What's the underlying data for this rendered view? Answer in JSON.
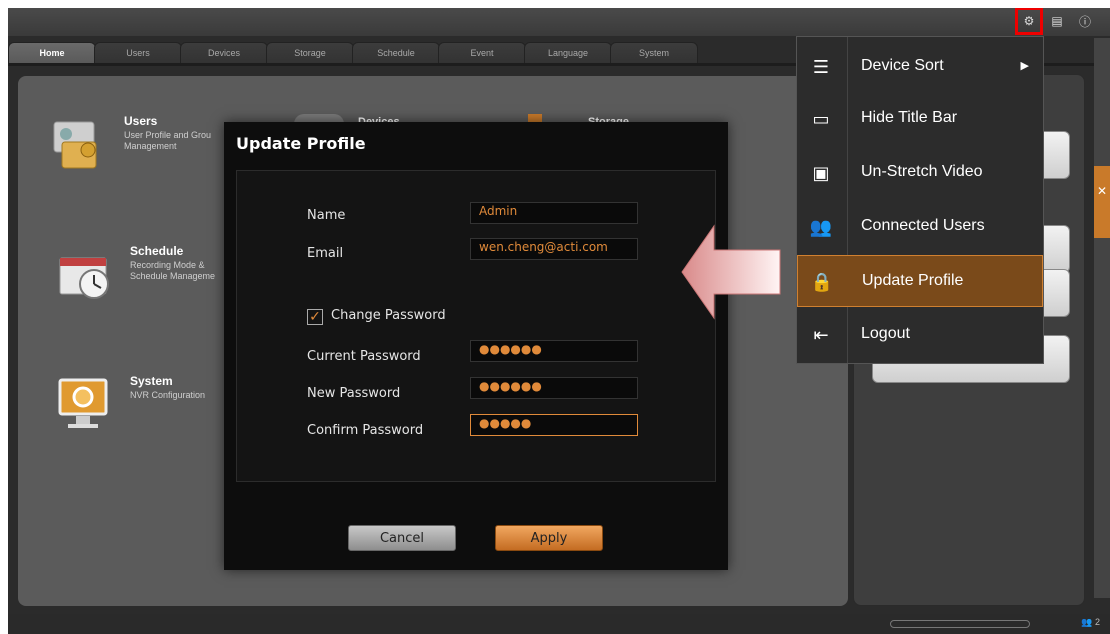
{
  "tabs": [
    "Home",
    "Users",
    "Devices",
    "Storage",
    "Schedule",
    "Event",
    "Language",
    "System"
  ],
  "home_items": [
    {
      "title": "Users",
      "desc": "User Profile and Grou\nManagement"
    },
    {
      "title": "Schedule",
      "desc": "Recording Mode &\nSchedule Manageme"
    },
    {
      "title": "System",
      "desc": "NVR Configuration"
    }
  ],
  "occluded": {
    "devices": "Devices",
    "storage": "Storage"
  },
  "dialog": {
    "title": "Update Profile",
    "name_label": "Name",
    "name_value": "Admin",
    "email_label": "Email",
    "email_value": "wen.cheng@acti.com",
    "change_password_label": "Change Password",
    "change_password_checked": true,
    "current_password_label": "Current Password",
    "current_password_value": "●●●●●●",
    "new_password_label": "New Password",
    "new_password_value": "●●●●●●",
    "confirm_password_label": "Confirm Password",
    "confirm_password_value": "●●●●●",
    "cancel_label": "Cancel",
    "apply_label": "Apply"
  },
  "menu": [
    {
      "label": "Device Sort",
      "icon": "list-icon",
      "submenu": true
    },
    {
      "label": "Hide Title Bar",
      "icon": "window-frame-icon"
    },
    {
      "label": "Un-Stretch Video",
      "icon": "video-frame-icon"
    },
    {
      "label": "Connected Users",
      "icon": "users-icon"
    },
    {
      "label": "Update Profile",
      "icon": "lock-icon",
      "active": true
    },
    {
      "label": "Logout",
      "icon": "logout-icon"
    }
  ],
  "status": {
    "users_count": "2"
  },
  "colors": {
    "accent": "#e08a3a",
    "highlight_box": "#ee0000",
    "menu_active_bg": "#7a4a1a"
  }
}
